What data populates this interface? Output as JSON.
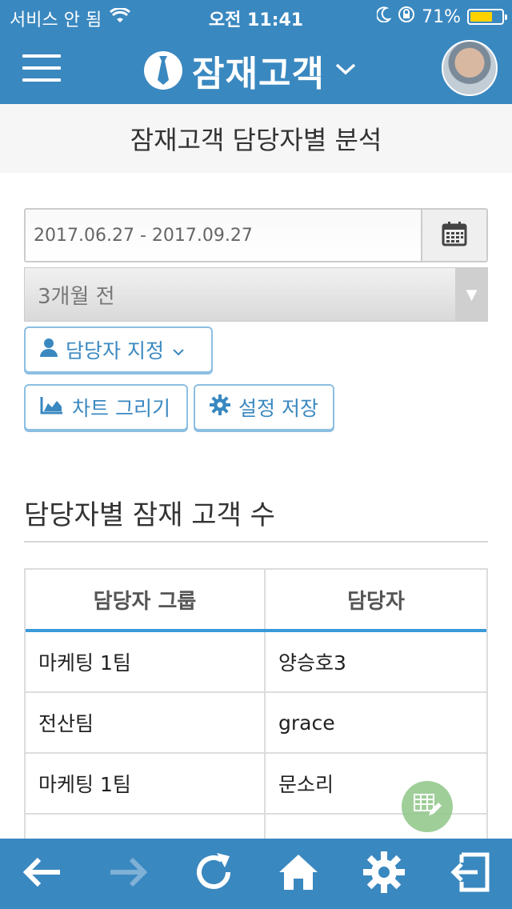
{
  "status_bar": {
    "carrier": "서비스 안 됨",
    "time": "오전 11:41",
    "battery": "71%",
    "battery_level": 0.71
  },
  "header": {
    "title": "잠재고객",
    "icons": [
      "menu-icon",
      "tie-icon",
      "chevron-down-icon",
      "avatar"
    ]
  },
  "subheader": {
    "title": "잠재고객 담당자별 분석"
  },
  "filters": {
    "date_range": "2017.06.27 - 2017.09.27",
    "period_select": "3개월 전",
    "assign_button": "담당자 지정",
    "chart_button": "차트 그리기",
    "save_button": "설정 저장"
  },
  "section": {
    "title": "담당자별 잠재 고객 수"
  },
  "table": {
    "headers": [
      "담당자 그룹",
      "담당자"
    ],
    "rows": [
      [
        "마케팅 1팀",
        "양승호3"
      ],
      [
        "전산팀",
        "grace"
      ],
      [
        "마케팅 1팀",
        "문소리"
      ]
    ]
  },
  "colors": {
    "primary": "#3a88c0",
    "table_accent": "#3a9ad9",
    "fab": "#95c98e"
  }
}
